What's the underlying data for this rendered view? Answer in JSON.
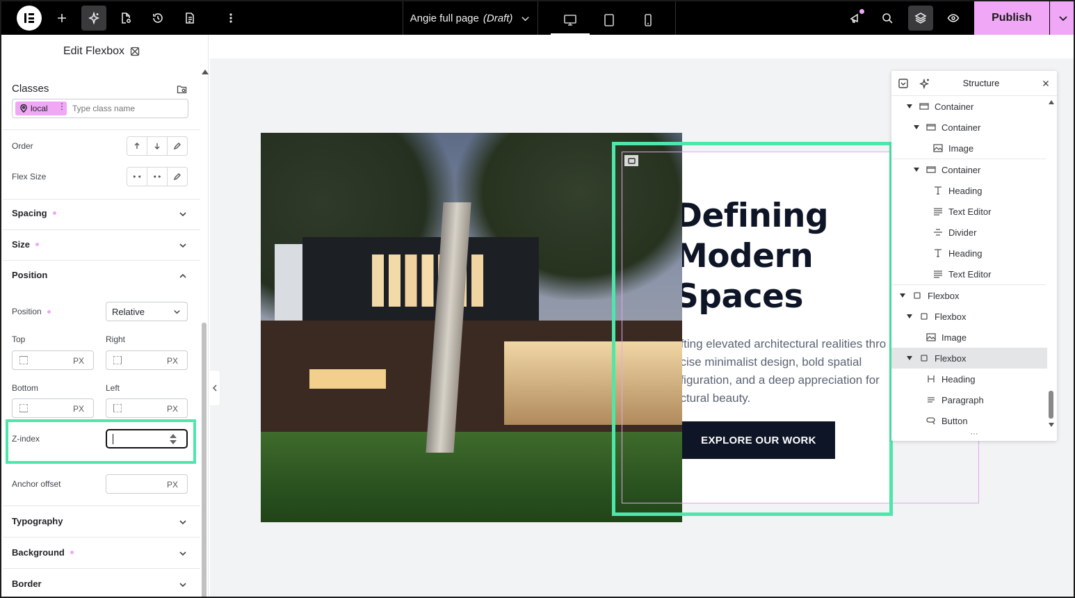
{
  "topbar": {
    "page_name": "Angie full page",
    "page_status": "(Draft)",
    "publish_label": "Publish"
  },
  "panel": {
    "title": "Edit Flexbox",
    "classes_label": "Classes",
    "class_chip": "local",
    "class_placeholder": "Type class name",
    "order_label": "Order",
    "flex_size_label": "Flex Size",
    "sections": {
      "spacing": "Spacing",
      "size": "Size",
      "position": "Position",
      "typography": "Typography",
      "background": "Background",
      "border": "Border"
    },
    "position_label": "Position",
    "position_value": "Relative",
    "top_label": "Top",
    "right_label": "Right",
    "bottom_label": "Bottom",
    "left_label": "Left",
    "unit": "PX",
    "zindex_label": "Z-index",
    "zindex_value": "",
    "anchor_offset_label": "Anchor offset"
  },
  "canvas": {
    "headline": [
      "Defining",
      "Modern",
      "Spaces"
    ],
    "paragraph": [
      "afting elevated architectural realities thro",
      "ecise minimalist design, bold spatial",
      "nfiguration, and a deep appreciation for",
      "uctural beauty."
    ],
    "cta": "EXPLORE OUR WORK"
  },
  "structure": {
    "title": "Structure",
    "items": [
      {
        "label": "Container"
      },
      {
        "label": "Container"
      },
      {
        "label": "Image"
      },
      {
        "label": "Container"
      },
      {
        "label": "Heading"
      },
      {
        "label": "Text Editor"
      },
      {
        "label": "Divider"
      },
      {
        "label": "Heading"
      },
      {
        "label": "Text Editor"
      },
      {
        "label": "Flexbox"
      },
      {
        "label": "Flexbox"
      },
      {
        "label": "Image"
      },
      {
        "label": "Flexbox"
      },
      {
        "label": "Heading"
      },
      {
        "label": "Paragraph"
      },
      {
        "label": "Button"
      }
    ]
  },
  "colors": {
    "accent_pink": "#f0a7f5",
    "highlight_green": "#4fe6ab",
    "dark_navy": "#0e1526"
  }
}
